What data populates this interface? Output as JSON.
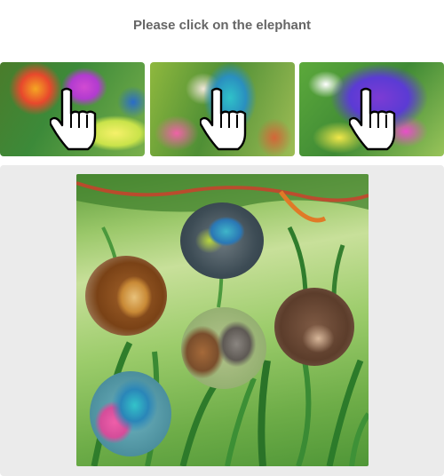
{
  "prompt": {
    "text": "Please click on the elephant"
  },
  "examples": [
    {
      "name": "example-image-1",
      "hint_icon": "pointing-hand-icon"
    },
    {
      "name": "example-image-2",
      "hint_icon": "pointing-hand-icon"
    },
    {
      "name": "example-image-3",
      "hint_icon": "pointing-hand-icon"
    }
  ],
  "challenge": {
    "animals": [
      "parrot",
      "lion",
      "squirrel",
      "bear",
      "elephant"
    ]
  },
  "colors": {
    "panel_background": "#ebebeb",
    "prompt_text": "#666666",
    "page_background": "#ffffff"
  }
}
